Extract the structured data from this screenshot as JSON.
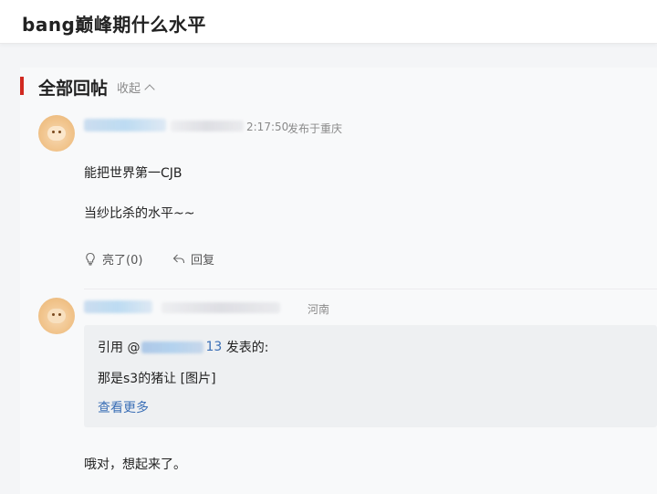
{
  "page": {
    "title": "bang巅峰期什么水平"
  },
  "section": {
    "title": "全部回帖",
    "collapse_label": "收起"
  },
  "posts": [
    {
      "time_suffix": "2:17:50",
      "location": "发布于重庆",
      "lines": [
        "能把世界第一CJB",
        "当纱比杀的水平~~"
      ],
      "like_label": "亮了(0)",
      "reply_label": "回复"
    },
    {
      "location": "河南",
      "quote": {
        "prefix": "引用 @",
        "user_tail": "13",
        "suffix": " 发表的:",
        "text": "那是s3的猪让 [图片]",
        "more_label": "查看更多"
      },
      "body": "哦对，想起来了。"
    }
  ],
  "colors": {
    "accent": "#d12a21",
    "link": "#3b6fb6"
  }
}
